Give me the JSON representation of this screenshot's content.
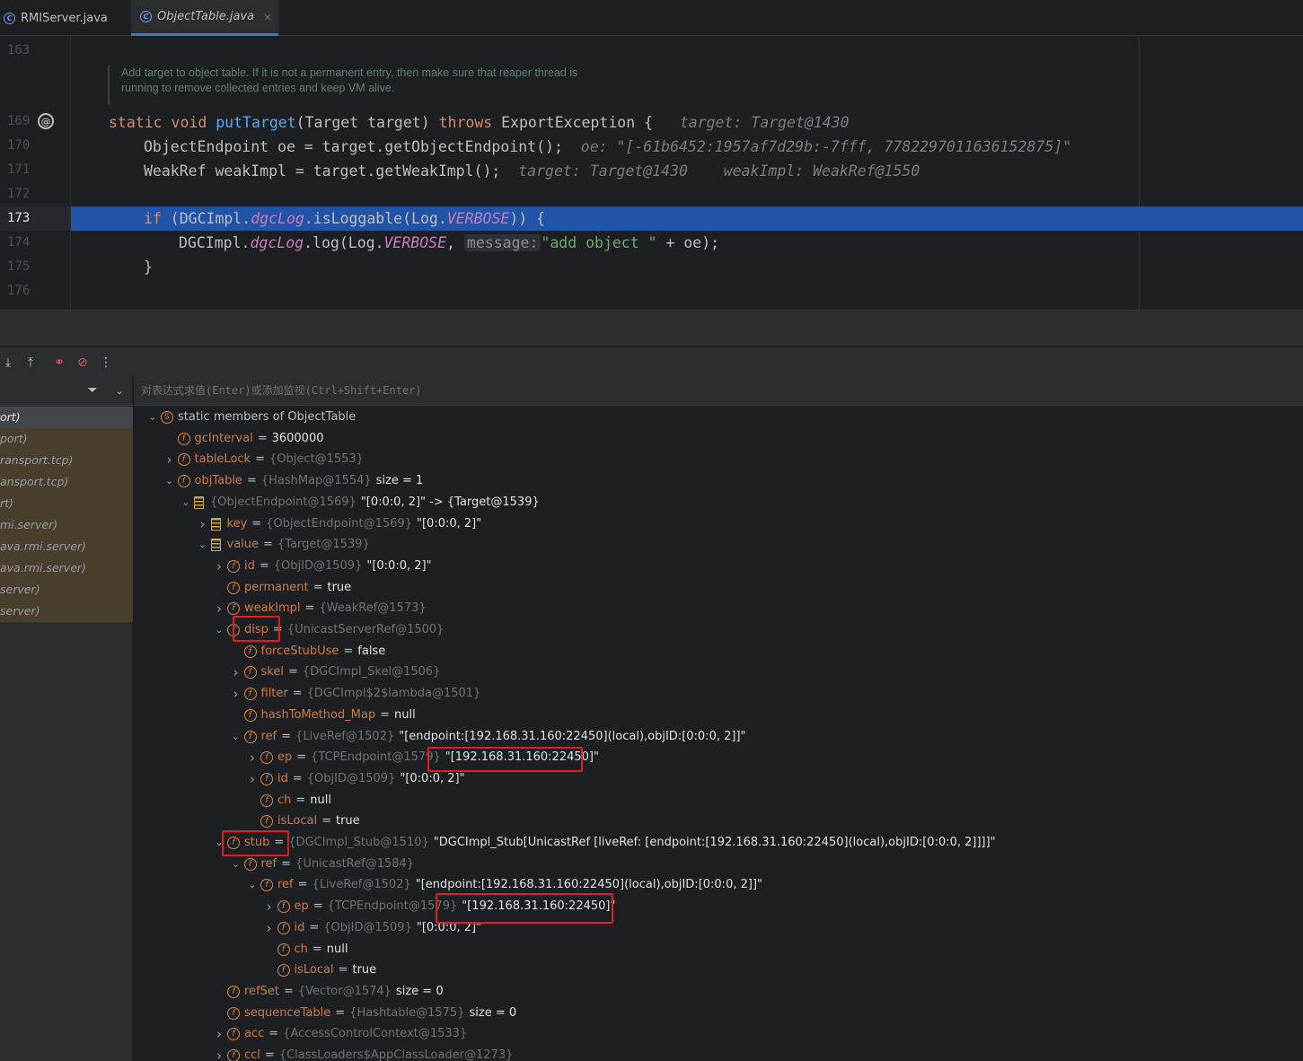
{
  "tabs": [
    {
      "label": "RMIServer.java"
    },
    {
      "label": "ObjectTable.java",
      "close": "×"
    }
  ],
  "editor": {
    "line_numbers": [
      "163",
      "169",
      "170",
      "171",
      "172",
      "173",
      "174",
      "175",
      "176"
    ],
    "doc_comment": [
      "Add target to object table. If it is not a permanent entry, then make sure that reaper thread is",
      "running to remove collected entries and keep VM alive."
    ],
    "lines": {
      "l169": {
        "kw1": "static void ",
        "fn": "putTarget",
        "rest1": "(Target target) ",
        "kw2": "throws",
        "rest2": " ExportException {",
        "hint": "target: Target@1430"
      },
      "l170": {
        "code": "ObjectEndpoint oe = target.getObjectEndpoint();",
        "hint": "oe: \"[-61b6452:1957af7d29b:-7fff, 7782297011636152875]\""
      },
      "l171": {
        "code": "WeakRef weakImpl = target.getWeakImpl();",
        "hint1": "target: Target@1430",
        "hint2": "weakImpl: WeakRef@1550"
      },
      "l173": {
        "kw": "if",
        "a": " (DGCImpl.",
        "s1": "dgcLog",
        "b": ".isLoggable(Log.",
        "s2": "VERBOSE",
        "c": ")) {"
      },
      "l174": {
        "a": "DGCImpl.",
        "s1": "dgcLog",
        "b": ".log(Log.",
        "s2": "VERBOSE",
        "c": ", ",
        "inlay": "message:",
        "str": "\"add object \"",
        "d": " + oe);"
      },
      "l175": {
        "code": "}"
      }
    }
  },
  "debugger": {
    "eval_placeholder": "对表达式求值(Enter)或添加监视(Ctrl+Shift+Enter)",
    "frames": [
      "ort)",
      "port)",
      "ransport.tcp)",
      "ansport.tcp)",
      "rt)",
      "mi.server)",
      "ava.rmi.server)",
      "ava.rmi.server)",
      "server)",
      "server)"
    ],
    "variables": [
      {
        "name": "static members of ObjectTable",
        "type": "",
        "value": ""
      },
      {
        "name": "gcInterval",
        "type": "",
        "value": "3600000"
      },
      {
        "name": "tableLock",
        "type": "{Object@1553}",
        "value": ""
      },
      {
        "name": "objTable",
        "type": "{HashMap@1554}",
        "value": "size = 1"
      },
      {
        "name": "",
        "type": "{ObjectEndpoint@1569}",
        "value": "\"[0:0:0, 2]\" -> {Target@1539}"
      },
      {
        "name": "key",
        "type": "{ObjectEndpoint@1569}",
        "value": "\"[0:0:0, 2]\""
      },
      {
        "name": "value",
        "type": "{Target@1539}",
        "value": ""
      },
      {
        "name": "id",
        "type": "{ObjID@1509}",
        "value": "\"[0:0:0, 2]\""
      },
      {
        "name": "permanent",
        "type": "",
        "value": "true"
      },
      {
        "name": "weakImpl",
        "type": "{WeakRef@1573}",
        "value": ""
      },
      {
        "name": "disp",
        "type": "{UnicastServerRef@1500}",
        "value": ""
      },
      {
        "name": "forceStubUse",
        "type": "",
        "value": "false"
      },
      {
        "name": "skel",
        "type": "{DGCImpl_Skel@1506}",
        "value": ""
      },
      {
        "name": "filter",
        "type": "{DGCImpl$2$lambda@1501}",
        "value": ""
      },
      {
        "name": "hashToMethod_Map",
        "type": "",
        "value": "null"
      },
      {
        "name": "ref",
        "type": "{LiveRef@1502}",
        "value": "\"[endpoint:[192.168.31.160:22450](local),objID:[0:0:0, 2]]\""
      },
      {
        "name": "ep",
        "type": "{TCPEndpoint@1579}",
        "value": "\"[192.168.31.160:22450]\""
      },
      {
        "name": "id",
        "type": "{ObjID@1509}",
        "value": "\"[0:0:0, 2]\""
      },
      {
        "name": "ch",
        "type": "",
        "value": "null"
      },
      {
        "name": "isLocal",
        "type": "",
        "value": "true"
      },
      {
        "name": "stub",
        "type": "{DGCImpl_Stub@1510}",
        "value": "\"DGCImpl_Stub[UnicastRef [liveRef: [endpoint:[192.168.31.160:22450](local),objID:[0:0:0, 2]]]]\""
      },
      {
        "name": "ref",
        "type": "{UnicastRef@1584}",
        "value": ""
      },
      {
        "name": "ref",
        "type": "{LiveRef@1502}",
        "value": "\"[endpoint:[192.168.31.160:22450](local),objID:[0:0:0, 2]]\""
      },
      {
        "name": "ep",
        "type": "{TCPEndpoint@1579}",
        "value": "\"[192.168.31.160:22450]\""
      },
      {
        "name": "id",
        "type": "{ObjID@1509}",
        "value": "\"[0:0:0, 2]\""
      },
      {
        "name": "ch",
        "type": "",
        "value": "null"
      },
      {
        "name": "isLocal",
        "type": "",
        "value": "true"
      },
      {
        "name": "refSet",
        "type": "{Vector@1574}",
        "value": "size = 0"
      },
      {
        "name": "sequenceTable",
        "type": "{Hashtable@1575}",
        "value": "size = 0"
      },
      {
        "name": "acc",
        "type": "{AccessControlContext@1533}",
        "value": ""
      },
      {
        "name": "ccl",
        "type": "{ClassLoaders$AppClassLoader@1273}",
        "value": ""
      }
    ]
  },
  "colors": {
    "selection": "#2154a6",
    "highlight_box": "#e02020",
    "field_icon": "#d6884a"
  }
}
